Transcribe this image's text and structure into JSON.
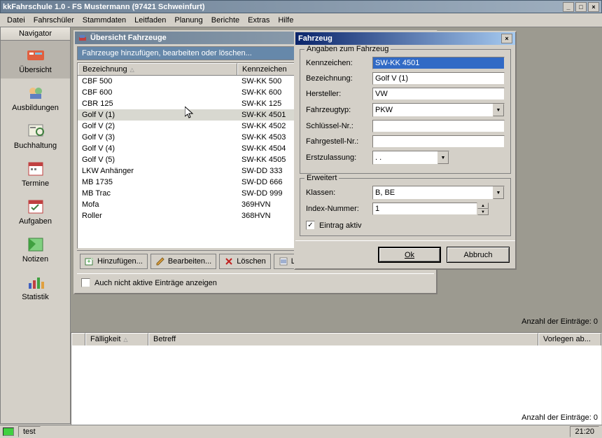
{
  "window": {
    "title": "kkFahrschule 1.0  -  FS Mustermann (97421 Schweinfurt)"
  },
  "menus": [
    "Datei",
    "Fahrschüler",
    "Stammdaten",
    "Leitfaden",
    "Planung",
    "Berichte",
    "Extras",
    "Hilfe"
  ],
  "navigator": {
    "header": "Navigator",
    "items": [
      {
        "label": "Übersicht",
        "selected": true
      },
      {
        "label": "Ausbildungen"
      },
      {
        "label": "Buchhaltung"
      },
      {
        "label": "Termine"
      },
      {
        "label": "Aufgaben"
      },
      {
        "label": "Notizen"
      },
      {
        "label": "Statistik"
      }
    ]
  },
  "overview": {
    "window_title": "Übersicht Fahrzeuge",
    "subtitle": "Fahrzeuge hinzufügen, bearbeiten oder löschen...",
    "columns": {
      "bez": "Bezeichnung",
      "kenn": "Kennzeichen"
    },
    "rows": [
      {
        "bez": "CBF 500",
        "kenn": "SW-KK 500"
      },
      {
        "bez": "CBF 600",
        "kenn": "SW-KK 600"
      },
      {
        "bez": "CBR 125",
        "kenn": "SW-KK 125"
      },
      {
        "bez": "Golf V (1)",
        "kenn": "SW-KK 4501",
        "selected": true
      },
      {
        "bez": "Golf V (2)",
        "kenn": "SW-KK 4502"
      },
      {
        "bez": "Golf V (3)",
        "kenn": "SW-KK 4503"
      },
      {
        "bez": "Golf V (4)",
        "kenn": "SW-KK 4504"
      },
      {
        "bez": "Golf V (5)",
        "kenn": "SW-KK 4505"
      },
      {
        "bez": "LKW Anhänger",
        "kenn": "SW-DD 333"
      },
      {
        "bez": "MB 1735",
        "kenn": "SW-DD 666"
      },
      {
        "bez": "MB Trac",
        "kenn": "SW-DD 999"
      },
      {
        "bez": "Mofa",
        "kenn": "369HVN"
      },
      {
        "bez": "Roller",
        "kenn": "368HVN"
      }
    ],
    "toolbar": {
      "add": "Hinzufügen...",
      "edit": "Bearbeiten...",
      "del": "Löschen",
      "list": "Liste"
    },
    "inactive_chk": "Auch nicht aktive Einträge anzeigen"
  },
  "dialog": {
    "title": "Fahrzeug",
    "group1_label": "Angaben zum Fahrzeug",
    "labels": {
      "kennzeichen": "Kennzeichen:",
      "bezeichnung": "Bezeichnung:",
      "hersteller": "Hersteller:",
      "fahrzeugtyp": "Fahrzeugtyp:",
      "schluessel": "Schlüssel-Nr.:",
      "fahrgestell": "Fahrgestell-Nr.:",
      "erstzulassung": "Erstzulassung:"
    },
    "values": {
      "kennzeichen": "SW-KK 4501",
      "bezeichnung": "Golf V (1)",
      "hersteller": "VW",
      "fahrzeugtyp": "PKW",
      "schluessel": "",
      "fahrgestell": "",
      "erstzulassung": "  .  ."
    },
    "group2_label": "Erweitert",
    "labels2": {
      "klassen": "Klassen:",
      "index": "Index-Nummer:"
    },
    "values2": {
      "klassen": "B, BE",
      "index": "1"
    },
    "eintrag_aktiv": "Eintrag aktiv",
    "buttons": {
      "ok": "Ok",
      "cancel": "Abbruch"
    }
  },
  "bottom": {
    "columns": {
      "fall": "Fälligkeit",
      "betreff": "Betreff",
      "vorl": "Vorlegen ab..."
    },
    "info1": "Anzahl der Einträge: 0",
    "info2": "Anzahl der Einträge: 0"
  },
  "status": {
    "text": "test",
    "time": "21:20"
  }
}
